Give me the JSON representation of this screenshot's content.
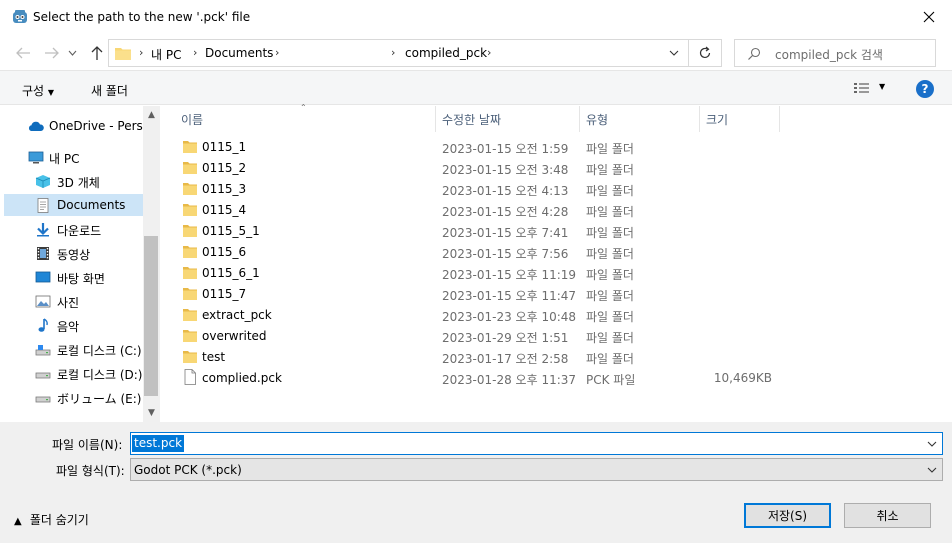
{
  "window": {
    "title": "Select the path to the new '.pck' file"
  },
  "address": {
    "crumbs": [
      "내 PC",
      "Documents",
      "compiled_pck"
    ]
  },
  "search": {
    "placeholder": "compiled_pck 검색"
  },
  "toolbar": {
    "organize": "구성",
    "new_folder": "새 폴더",
    "help": "?"
  },
  "sidebar": {
    "items": [
      {
        "label": "OneDrive - Personal",
        "icon": "onedrive-icon"
      },
      {
        "label": "내 PC",
        "icon": "pc-icon"
      },
      {
        "label": "3D 개체",
        "icon": "3d-objects-icon"
      },
      {
        "label": "Documents",
        "icon": "documents-icon"
      },
      {
        "label": "다운로드",
        "icon": "downloads-icon"
      },
      {
        "label": "동영상",
        "icon": "videos-icon"
      },
      {
        "label": "바탕 화면",
        "icon": "desktop-icon"
      },
      {
        "label": "사진",
        "icon": "pictures-icon"
      },
      {
        "label": "음악",
        "icon": "music-icon"
      },
      {
        "label": "로컬 디스크 (C:)",
        "icon": "drive-icon"
      },
      {
        "label": "로컬 디스크 (D:)",
        "icon": "drive-icon"
      },
      {
        "label": "ボリューム (E:)",
        "icon": "drive-icon"
      }
    ]
  },
  "list": {
    "columns": {
      "name": "이름",
      "date": "수정한 날짜",
      "type": "유형",
      "size": "크기"
    },
    "rows": [
      {
        "name": "0115_1",
        "date": "2023-01-15 오전 1:59",
        "type": "파일 폴더",
        "size": "",
        "kind": "folder"
      },
      {
        "name": "0115_2",
        "date": "2023-01-15 오전 3:48",
        "type": "파일 폴더",
        "size": "",
        "kind": "folder"
      },
      {
        "name": "0115_3",
        "date": "2023-01-15 오전 4:13",
        "type": "파일 폴더",
        "size": "",
        "kind": "folder"
      },
      {
        "name": "0115_4",
        "date": "2023-01-15 오전 4:28",
        "type": "파일 폴더",
        "size": "",
        "kind": "folder"
      },
      {
        "name": "0115_5_1",
        "date": "2023-01-15 오후 7:41",
        "type": "파일 폴더",
        "size": "",
        "kind": "folder"
      },
      {
        "name": "0115_6",
        "date": "2023-01-15 오후 7:56",
        "type": "파일 폴더",
        "size": "",
        "kind": "folder"
      },
      {
        "name": "0115_6_1",
        "date": "2023-01-15 오후 11:19",
        "type": "파일 폴더",
        "size": "",
        "kind": "folder"
      },
      {
        "name": "0115_7",
        "date": "2023-01-15 오후 11:47",
        "type": "파일 폴더",
        "size": "",
        "kind": "folder"
      },
      {
        "name": "extract_pck",
        "date": "2023-01-23 오후 10:48",
        "type": "파일 폴더",
        "size": "",
        "kind": "folder"
      },
      {
        "name": "overwrited",
        "date": "2023-01-29 오전 1:51",
        "type": "파일 폴더",
        "size": "",
        "kind": "folder"
      },
      {
        "name": "test",
        "date": "2023-01-17 오전 2:58",
        "type": "파일 폴더",
        "size": "",
        "kind": "folder"
      },
      {
        "name": "complied.pck",
        "date": "2023-01-28 오후 11:37",
        "type": "PCK 파일",
        "size": "10,469KB",
        "kind": "file"
      }
    ]
  },
  "form": {
    "filename_label": "파일 이름(N):",
    "filename_value": "test.pck",
    "filetype_label": "파일 형식(T):",
    "filetype_value": "Godot PCK (*.pck)"
  },
  "footer": {
    "hide_folders": "폴더 숨기기",
    "save": "저장(S)",
    "cancel": "취소"
  },
  "colors": {
    "accent": "#0078d7",
    "folder": "#f8d775",
    "selected_bg": "#cce4f7"
  }
}
